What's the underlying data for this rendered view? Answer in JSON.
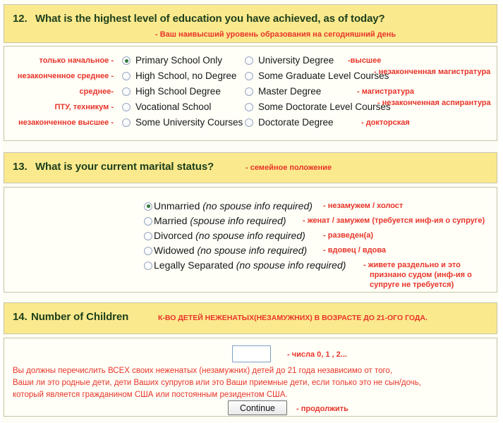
{
  "q12": {
    "number": "12.",
    "title": "What is the highest level of education you have achieved, as of today?",
    "subtitle_ru": "- Ваш наивысший уровень образования на сегодняшний день",
    "left_labels": [
      "только начальное -",
      "незаконченное среднее -",
      "среднее-",
      "ПТУ, техникум -",
      "незаконченное высшее -"
    ],
    "left_options": [
      "Primary School Only",
      "High School, no Degree",
      "High School Degree",
      "Vocational School",
      "Some University Courses"
    ],
    "left_selected_index": 0,
    "right_options": [
      "University Degree",
      "Some Graduate Level Courses",
      "Master Degree",
      "Some Doctorate Level Courses",
      "Doctorate Degree"
    ],
    "right_labels": [
      "-высшее",
      "- незаконченная магистратура",
      "- магистратура",
      "- незаконченная аспирантура",
      "- докторская"
    ],
    "right_selected_index": -1
  },
  "q13": {
    "number": "13.",
    "title": "What is your current marital status?",
    "subtitle_ru": "- семейное положение",
    "options": [
      {
        "label": "Unmarried ",
        "note": "(no spouse info required)",
        "ru": "- незамужем / холост"
      },
      {
        "label": "Married ",
        "note": "(spouse info required)",
        "ru": "- женат / замужем (требуется инф-ия о супруге)"
      },
      {
        "label": "Divorced ",
        "note": "(no spouse info required)",
        "ru": "- разведен(а)"
      },
      {
        "label": "Widowed ",
        "note": "(no spouse info required)",
        "ru": "- вдовец / вдова"
      },
      {
        "label": "Legally Separated ",
        "note": "(no spouse info required)",
        "ru": "- живете раздельно и это"
      }
    ],
    "selected_index": 0,
    "separated_ru_line2": "признано судом (инф-ия о",
    "separated_ru_line3": "супруге не требуется)"
  },
  "q14": {
    "number": "14.",
    "title": "Number of Children",
    "subtitle_ru": "К-ВО ДЕТЕЙ НЕЖЕНАТЫХ(НЕЗАМУЖНИХ) В ВОЗРАСТЕ ДО 21-ОГО ГОДА.",
    "input_value": "",
    "input_placeholder": "",
    "input_hint_ru": "- числа 0, 1 , 2...",
    "paragraph": [
      "Вы должны перечислить ВСЕХ своих неженатых (незамужних) детей до 21 года независимо от того,",
      "Ваши ли это родные дети, дети Ваших супругов или это Ваши приемные дети,  если только это не сын/дочь,",
      "который является гражданином США или постоянным резидентом США."
    ],
    "continue_label": "Continue",
    "continue_ru": "- продолжить"
  },
  "colors": {
    "header_band": "#fbe98d",
    "panel_bg": "#fffff7",
    "border": "#c8c4a8",
    "title_green": "#1c3f1c",
    "red": "#e8342a",
    "radio_dot": "#2f7a3a"
  }
}
